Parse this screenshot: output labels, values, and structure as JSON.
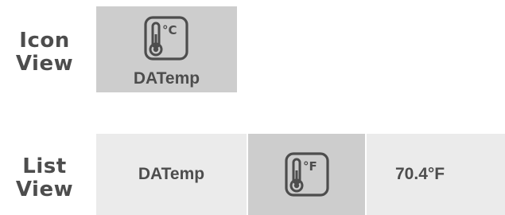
{
  "icon_view": {
    "heading": "Icon\nView",
    "tile": {
      "icon": "thermometer-celsius-icon",
      "unit_glyph": "°C",
      "label": "DATemp"
    }
  },
  "list_view": {
    "heading": "List\nView",
    "row": {
      "name": "DATemp",
      "icon": "thermometer-fahrenheit-icon",
      "unit_glyph": "°F",
      "value": "70.4°F"
    }
  },
  "colors": {
    "text": "#4d4d4d",
    "icon_tile_bg": "#cdcdcd",
    "list_cell_bg": "#ebebeb",
    "icon_stroke": "#4d4d4d"
  }
}
